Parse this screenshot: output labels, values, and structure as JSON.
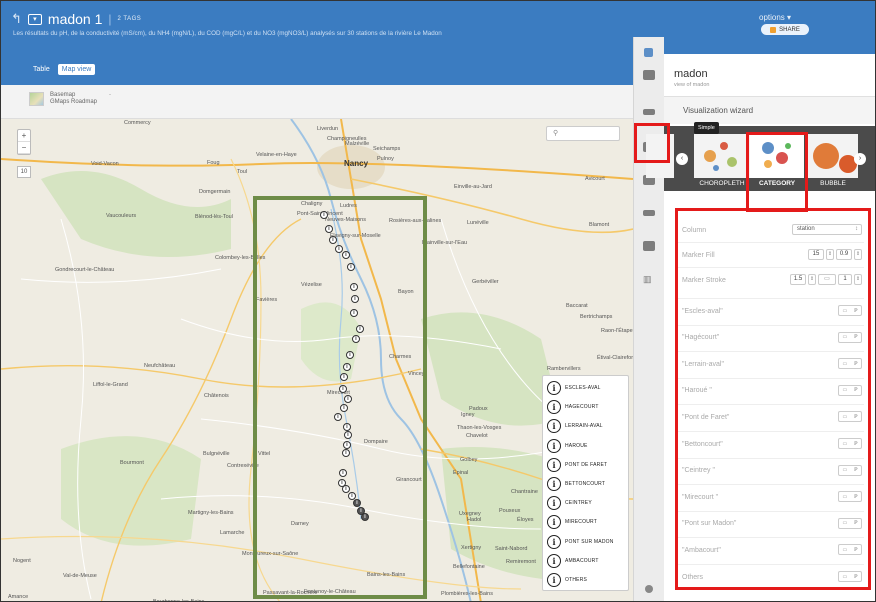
{
  "header": {
    "back_icon": "back-arrow-icon",
    "title": "madon 1",
    "tags": "2 TAGS",
    "description": "Les résultats du pH, de la conductivité (mS/cm), du NH4 (mgN/L), du COD (mgC/L) et du NO3 (mgNO3/L) analysés sur 30 stations de la rivière Le Madon",
    "options_label": "options",
    "share_label": "SHARE",
    "tabs": [
      {
        "label": "Table"
      },
      {
        "label": "Map view"
      }
    ]
  },
  "basemap": {
    "line1": "Basemap",
    "line2": "GMaps Roadmap",
    "dash": "-"
  },
  "map": {
    "zoom_in": "+",
    "zoom_out": "−",
    "zoom_level": "10",
    "search_icon": "search-icon",
    "places": [
      {
        "name": "Commercy"
      },
      {
        "name": "Liverdun"
      },
      {
        "name": "Champigneulles"
      },
      {
        "name": "Malzéville"
      },
      {
        "name": "Seichamps"
      },
      {
        "name": "Velaine-en-Haye"
      },
      {
        "name": "Nancy",
        "big": true
      },
      {
        "name": "Pulnoy"
      },
      {
        "name": "Foug"
      },
      {
        "name": "Toul"
      },
      {
        "name": "Void-Vacon"
      },
      {
        "name": "Domgermain"
      },
      {
        "name": "Einville-au-Jard"
      },
      {
        "name": "Vaucouleurs"
      },
      {
        "name": "Blénod-lès-Toul"
      },
      {
        "name": "Chaligny"
      },
      {
        "name": "Ludres"
      },
      {
        "name": "Pont-Saint-Vincent"
      },
      {
        "name": "Rosières-aux-Salines"
      },
      {
        "name": "Lunéville"
      },
      {
        "name": "Neuves-Maisons"
      },
      {
        "name": "Flavigny-sur-Moselle"
      },
      {
        "name": "Blainville-sur-l'Eau"
      },
      {
        "name": "Gondrecourt-le-Château"
      },
      {
        "name": "Colombey-les-Belles"
      },
      {
        "name": "Vézelise"
      },
      {
        "name": "Bayon"
      },
      {
        "name": "Gerbéviller"
      },
      {
        "name": "Favières"
      },
      {
        "name": "Baccarat"
      },
      {
        "name": "Bertrichamps"
      },
      {
        "name": "Raon-l'Étape"
      },
      {
        "name": "Charmes"
      },
      {
        "name": "Neufchâteau"
      },
      {
        "name": "Étival-Clairefontaine"
      },
      {
        "name": "Vincey"
      },
      {
        "name": "Rambervillers"
      },
      {
        "name": "Liffol-le-Grand"
      },
      {
        "name": "Châtenois"
      },
      {
        "name": "Mirecourt"
      },
      {
        "name": "Padoux"
      },
      {
        "name": "Igney"
      },
      {
        "name": "Thaon-les-Vosges"
      },
      {
        "name": "Chavelot"
      },
      {
        "name": "Bulgnéville"
      },
      {
        "name": "Dompaire"
      },
      {
        "name": "Golbey"
      },
      {
        "name": "Épinal"
      },
      {
        "name": "Bourmont"
      },
      {
        "name": "Contrexéville"
      },
      {
        "name": "Vittel"
      },
      {
        "name": "Girancourt"
      },
      {
        "name": "Chantraine"
      },
      {
        "name": "Martigny-les-Bains"
      },
      {
        "name": "Lamarche"
      },
      {
        "name": "Darney"
      },
      {
        "name": "Uxegney"
      },
      {
        "name": "Hadol"
      },
      {
        "name": "Éloyes"
      },
      {
        "name": "Pouxeux"
      },
      {
        "name": "Monthureux-sur-Saône"
      },
      {
        "name": "Xertigny"
      },
      {
        "name": "Saint-Nabord"
      },
      {
        "name": "Remiremont"
      },
      {
        "name": "Nogent"
      },
      {
        "name": "Val-de-Meuse"
      },
      {
        "name": "Bains-les-Bains"
      },
      {
        "name": "Bellefontaine"
      },
      {
        "name": "Passavant-la-Rochère"
      },
      {
        "name": "Fontenoy-le-Château"
      },
      {
        "name": "Plombières-les-Bains"
      },
      {
        "name": "Bourbonne-les-Bains"
      },
      {
        "name": "Amance"
      },
      {
        "name": "Avicourt"
      },
      {
        "name": "Blamont"
      }
    ],
    "legend": [
      {
        "label": "ESCLES-AVAL"
      },
      {
        "label": "HAGECOURT"
      },
      {
        "label": "LERRAIN-AVAL"
      },
      {
        "label": "HAROUE"
      },
      {
        "label": "PONT DE FARET"
      },
      {
        "label": "BETTONCOURT"
      },
      {
        "label": "CEINTREY"
      },
      {
        "label": "MIRECOURT"
      },
      {
        "label": "PONT SUR MADON"
      },
      {
        "label": "AMBACOURT"
      },
      {
        "label": "OTHERS"
      }
    ]
  },
  "panel": {
    "title": "madon",
    "subtitle": "view of madon",
    "wizard_title": "Visualization wizard",
    "tooltip": "Simple",
    "thumbs": [
      {
        "label": "CHOROPLETH",
        "active": false
      },
      {
        "label": "CATEGORY",
        "active": true
      },
      {
        "label": "BUBBLE",
        "active": false
      }
    ],
    "column_label": "Column",
    "column_value": "station",
    "marker_fill_label": "Marker Fill",
    "marker_fill_size": "15",
    "marker_fill_opacity": "0.9",
    "marker_stroke_label": "Marker Stroke",
    "marker_stroke_width": "1.5",
    "marker_stroke_opacity": "1",
    "categories": [
      {
        "label": "\"Escles-aval\""
      },
      {
        "label": "\"Hagécourt\""
      },
      {
        "label": "\"Lerrain-aval\""
      },
      {
        "label": "\"Haroué \""
      },
      {
        "label": "\"Pont de Faret\""
      },
      {
        "label": "\"Bettoncourt\""
      },
      {
        "label": "\"Ceintrey \""
      },
      {
        "label": "\"Mirecourt \""
      },
      {
        "label": "\"Pont sur Madon\""
      },
      {
        "label": "\"Ambacourt\""
      },
      {
        "label": "Others"
      }
    ]
  },
  "colors": {
    "header_bg": "#3b7cc1",
    "highlight_red": "#e41a1a",
    "study_area_green": "#6e8c47",
    "carousel_bg": "#4b4b4b"
  }
}
